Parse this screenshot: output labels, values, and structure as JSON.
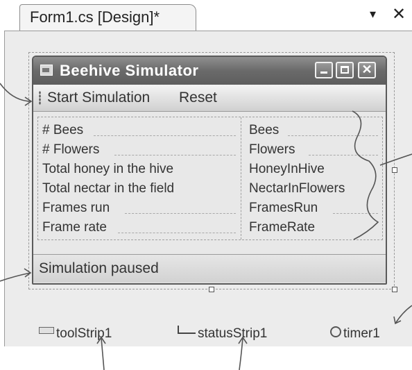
{
  "tab": {
    "title": "Form1.cs [Design]*",
    "menu_arrow": "▾",
    "close": "✕"
  },
  "form": {
    "title": "Beehive Simulator",
    "window_buttons": {
      "minimize": "",
      "maximize": "",
      "close": "✕"
    }
  },
  "toolstrip": {
    "items": [
      "Start Simulation",
      "Reset"
    ]
  },
  "stats": {
    "rows": [
      {
        "label": "# Bees",
        "value": "Bees"
      },
      {
        "label": "# Flowers",
        "value": "Flowers"
      },
      {
        "label": "Total honey in the hive",
        "value": "HoneyInHive"
      },
      {
        "label": "Total nectar in the field",
        "value": "NectarInFlowers"
      },
      {
        "label": "Frames run",
        "value": "FramesRun"
      },
      {
        "label": "Frame rate",
        "value": "FrameRate"
      }
    ]
  },
  "statusstrip": {
    "text": "Simulation paused"
  },
  "tray": {
    "items": [
      {
        "label": "toolStrip1",
        "icon": "toolstrip-icon"
      },
      {
        "label": "statusStrip1",
        "icon": "statusstrip-icon"
      },
      {
        "label": "timer1",
        "icon": "timer-icon"
      }
    ]
  },
  "colors": {
    "titlebar": "#6a6a6a",
    "surface": "#ececec",
    "annotation": "#555555"
  }
}
